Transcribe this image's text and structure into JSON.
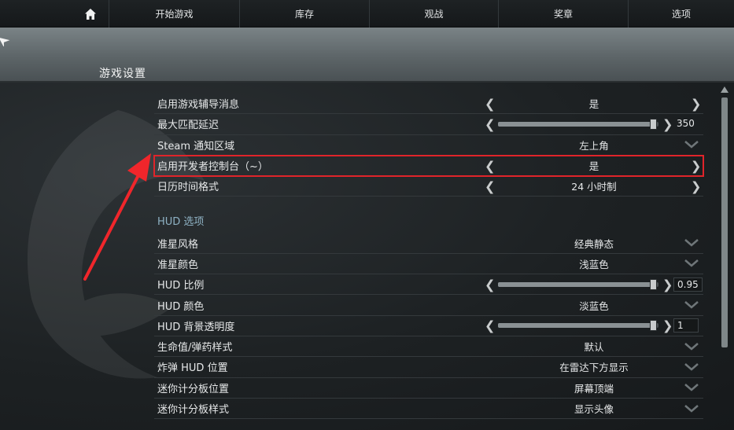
{
  "nav": {
    "items": [
      "开始游戏",
      "库存",
      "观战",
      "奖章",
      "选项"
    ]
  },
  "header": {
    "title": "游戏设置"
  },
  "settings": {
    "rows_top": [
      {
        "label": "启用游戏辅导消息",
        "value": "是",
        "control": "arrows"
      },
      {
        "label": "最大匹配延迟",
        "value": "350",
        "control": "slider",
        "level": 0.97
      },
      {
        "label": "Steam 通知区域",
        "value": "左上角",
        "control": "dropdown"
      },
      {
        "label": "启用开发者控制台（~）",
        "value": "是",
        "control": "arrows",
        "highlighted": true
      },
      {
        "label": "日历时间格式",
        "value": "24 小时制",
        "control": "arrows"
      }
    ],
    "hud_section_title": "HUD 选项",
    "rows_hud": [
      {
        "label": "准星风格",
        "value": "经典静态",
        "control": "dropdown"
      },
      {
        "label": "准星颜色",
        "value": "浅蓝色",
        "control": "dropdown"
      },
      {
        "label": "HUD 比例",
        "value": "0.95",
        "control": "slider",
        "level": 0.97
      },
      {
        "label": "HUD 颜色",
        "value": "淡蓝色",
        "control": "dropdown"
      },
      {
        "label": "HUD 背景透明度",
        "value": "1",
        "control": "slider",
        "level": 0.97
      },
      {
        "label": "生命值/弹药样式",
        "value": "默认",
        "control": "dropdown"
      },
      {
        "label": "炸弹 HUD 位置",
        "value": "在雷达下方显示",
        "control": "dropdown"
      },
      {
        "label": "迷你计分板位置",
        "value": "屏幕顶端",
        "control": "dropdown"
      },
      {
        "label": "迷你计分板样式",
        "value": "显示头像",
        "control": "dropdown"
      }
    ]
  },
  "colors": {
    "highlight": "#e0242a",
    "section_title": "#8fb2c4",
    "annotation_arrow": "#f0262b"
  },
  "icons": [
    "home-icon",
    "back-arrow-icon",
    "chevron-left-icon",
    "chevron-right-icon",
    "chevron-down-icon",
    "scroll-up-icon"
  ]
}
